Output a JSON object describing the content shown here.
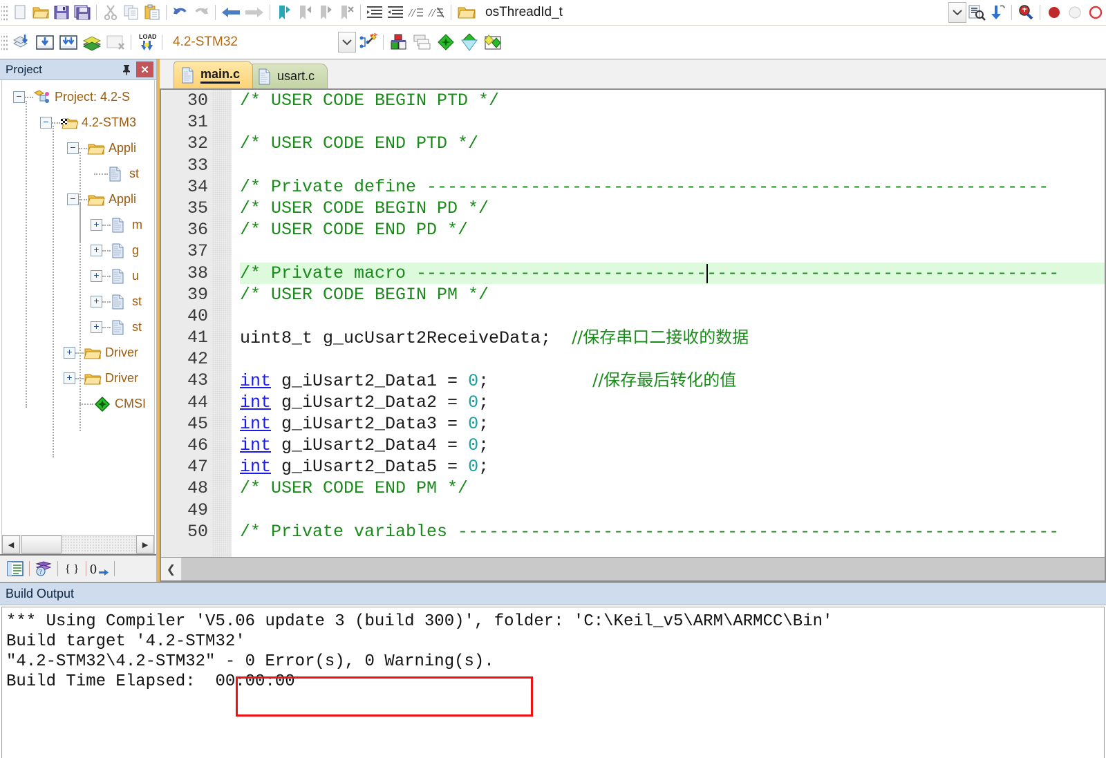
{
  "toolbar_top": {
    "icons": [
      {
        "name": "new-file-icon",
        "glyph": "new"
      },
      {
        "name": "open-file-icon",
        "glyph": "folder"
      },
      {
        "name": "save-icon",
        "glyph": "save"
      },
      {
        "name": "save-all-icon",
        "glyph": "saveall"
      },
      {
        "name": "cut-icon",
        "glyph": "cut"
      },
      {
        "name": "copy-icon",
        "glyph": "copy"
      },
      {
        "name": "paste-icon",
        "glyph": "paste"
      },
      {
        "name": "undo-icon",
        "glyph": "undo"
      },
      {
        "name": "redo-icon",
        "glyph": "redo"
      },
      {
        "name": "navigate-back-icon",
        "glyph": "back"
      },
      {
        "name": "navigate-forward-icon",
        "glyph": "forward"
      },
      {
        "name": "bookmark-toggle-icon",
        "glyph": "bm1"
      },
      {
        "name": "bookmark-prev-icon",
        "glyph": "bm2"
      },
      {
        "name": "bookmark-next-icon",
        "glyph": "bm3"
      },
      {
        "name": "bookmark-clear-icon",
        "glyph": "bm4"
      },
      {
        "name": "indent-icon",
        "glyph": "ind1"
      },
      {
        "name": "outdent-icon",
        "glyph": "ind2"
      },
      {
        "name": "comment-icon",
        "glyph": "com1"
      },
      {
        "name": "uncomment-icon",
        "glyph": "com2"
      }
    ],
    "symbol_icon": "find-symbol-icon",
    "symbol_value": "osThreadId_t",
    "right_icons": [
      {
        "name": "dropdown-arrow-icon",
        "glyph": "chev"
      },
      {
        "name": "find-in-files-icon",
        "glyph": "findfiles"
      },
      {
        "name": "insert-icon",
        "glyph": "insert"
      },
      {
        "name": "debug-magnifier-icon",
        "glyph": "dbgmag"
      },
      {
        "name": "breakpoint-set-icon",
        "glyph": "bpred"
      },
      {
        "name": "breakpoint-disabled-icon",
        "glyph": "bpgray"
      },
      {
        "name": "breakpoint-clear-icon",
        "glyph": "bphollow"
      }
    ]
  },
  "toolbar_build": {
    "icons": [
      {
        "name": "translate-icon",
        "glyph": "translate"
      },
      {
        "name": "build-icon",
        "glyph": "build"
      },
      {
        "name": "rebuild-icon",
        "glyph": "rebuild"
      },
      {
        "name": "batch-build-icon",
        "glyph": "batch"
      },
      {
        "name": "stop-build-icon",
        "glyph": "stopbuild"
      },
      {
        "name": "download-icon",
        "glyph": "load"
      }
    ],
    "target_label": "4.2-STM32",
    "target_dropdown_icon": "chevron-down-icon",
    "right_icons": [
      {
        "name": "target-options-wizard-icon",
        "glyph": "wizard"
      },
      {
        "name": "manage-project-items-icon",
        "glyph": "mgr"
      },
      {
        "name": "multi-project-icon",
        "glyph": "multi"
      },
      {
        "name": "pack-installer-icon",
        "glyph": "pack1"
      },
      {
        "name": "manage-runtime-env-icon",
        "glyph": "pack2"
      },
      {
        "name": "select-software-packs-icon",
        "glyph": "pack3"
      }
    ]
  },
  "project_panel": {
    "title": "Project",
    "pin_icon": "pin-icon",
    "close_icon": "close-icon",
    "tree": [
      {
        "label": "Project: 4.2-S",
        "icon": "project-icon",
        "expander": "−",
        "depth": 0
      },
      {
        "label": "4.2-STM3",
        "icon": "target-icon",
        "expander": "−",
        "depth": 1
      },
      {
        "label": "Appli",
        "icon": "folder-icon",
        "expander": "−",
        "depth": 2
      },
      {
        "label": "st",
        "icon": "file-icon",
        "expander": "",
        "depth": 3
      },
      {
        "label": "Appli",
        "icon": "folder-icon",
        "expander": "−",
        "depth": 2
      },
      {
        "label": "m",
        "icon": "file-icon",
        "expander": "+",
        "depth": 3
      },
      {
        "label": "g",
        "icon": "file-icon",
        "expander": "+",
        "depth": 3
      },
      {
        "label": "u",
        "icon": "file-icon",
        "expander": "+",
        "depth": 3
      },
      {
        "label": "st",
        "icon": "file-icon",
        "expander": "+",
        "depth": 3
      },
      {
        "label": "st",
        "icon": "file-icon",
        "expander": "+",
        "depth": 3
      },
      {
        "label": "Driver",
        "icon": "folder-icon",
        "expander": "+",
        "depth": 2
      },
      {
        "label": "Driver",
        "icon": "folder-icon",
        "expander": "+",
        "depth": 2
      },
      {
        "label": "CMSI",
        "icon": "cmsis-icon",
        "expander": "",
        "depth": 2
      }
    ],
    "hscroll": {
      "left_icon": "scroll-left-arrow-icon",
      "right_icon": "scroll-right-arrow-icon"
    },
    "bottom_tabs": [
      {
        "name": "project-view-tab",
        "glyph": "▤"
      },
      {
        "name": "books-view-tab",
        "glyph": "books"
      },
      {
        "name": "functions-view-tab",
        "glyph": "{}"
      },
      {
        "name": "templates-view-tab",
        "glyph": "0→"
      }
    ]
  },
  "editor": {
    "tabs": [
      {
        "label": "main.c",
        "active": true,
        "icon": "file-icon"
      },
      {
        "label": "usart.c",
        "active": false,
        "icon": "file-icon"
      }
    ],
    "first_line_number": 30,
    "highlight_line": 38,
    "lines": [
      {
        "n": 30,
        "segments": [
          {
            "t": "/* USER CODE BEGIN PTD */",
            "c": "cm"
          }
        ]
      },
      {
        "n": 31,
        "segments": []
      },
      {
        "n": 32,
        "segments": [
          {
            "t": "/* USER CODE END PTD */",
            "c": "cm"
          }
        ]
      },
      {
        "n": 33,
        "segments": []
      },
      {
        "n": 34,
        "segments": [
          {
            "t": "/* Private define ------------------------------------------------------------",
            "c": "cm"
          }
        ]
      },
      {
        "n": 35,
        "segments": [
          {
            "t": "/* USER CODE BEGIN PD */",
            "c": "cm"
          }
        ]
      },
      {
        "n": 36,
        "segments": [
          {
            "t": "/* USER CODE END PD */",
            "c": "cm"
          }
        ]
      },
      {
        "n": 37,
        "segments": []
      },
      {
        "n": 38,
        "segments": [
          {
            "t": "/* Private macro --------------------------------------------------------------",
            "c": "cm"
          }
        ]
      },
      {
        "n": 39,
        "segments": [
          {
            "t": "/* USER CODE BEGIN PM */",
            "c": "cm"
          }
        ]
      },
      {
        "n": 40,
        "segments": []
      },
      {
        "n": 41,
        "segments": [
          {
            "t": "uint8_t g_ucUsart2ReceiveData;  ",
            "c": ""
          },
          {
            "t": "//保存串口二接收的数据",
            "c": "cn"
          }
        ]
      },
      {
        "n": 42,
        "segments": []
      },
      {
        "n": 43,
        "segments": [
          {
            "t": "int",
            "c": "kw"
          },
          {
            "t": " g_iUsart2_Data1 = ",
            "c": ""
          },
          {
            "t": "0",
            "c": "num"
          },
          {
            "t": ";          ",
            "c": ""
          },
          {
            "t": "//保存最后转化的值",
            "c": "cn"
          }
        ]
      },
      {
        "n": 44,
        "segments": [
          {
            "t": "int",
            "c": "kw"
          },
          {
            "t": " g_iUsart2_Data2 = ",
            "c": ""
          },
          {
            "t": "0",
            "c": "num"
          },
          {
            "t": ";",
            "c": ""
          }
        ]
      },
      {
        "n": 45,
        "segments": [
          {
            "t": "int",
            "c": "kw"
          },
          {
            "t": " g_iUsart2_Data3 = ",
            "c": ""
          },
          {
            "t": "0",
            "c": "num"
          },
          {
            "t": ";",
            "c": ""
          }
        ]
      },
      {
        "n": 46,
        "segments": [
          {
            "t": "int",
            "c": "kw"
          },
          {
            "t": " g_iUsart2_Data4 = ",
            "c": ""
          },
          {
            "t": "0",
            "c": "num"
          },
          {
            "t": ";",
            "c": ""
          }
        ]
      },
      {
        "n": 47,
        "segments": [
          {
            "t": "int",
            "c": "kw"
          },
          {
            "t": " g_iUsart2_Data5 = ",
            "c": ""
          },
          {
            "t": "0",
            "c": "num"
          },
          {
            "t": ";",
            "c": ""
          }
        ]
      },
      {
        "n": 48,
        "segments": [
          {
            "t": "/* USER CODE END PM */",
            "c": "cm"
          }
        ]
      },
      {
        "n": 49,
        "segments": []
      },
      {
        "n": 50,
        "segments": [
          {
            "t": "/* Private variables ----------------------------------------------------------",
            "c": "cm"
          }
        ]
      }
    ],
    "hscroll_left_icon": "scroll-left-arrow-icon"
  },
  "build_output": {
    "title": "Build Output",
    "lines": [
      "*** Using Compiler 'V5.06 update 3 (build 300)', folder: 'C:\\Keil_v5\\ARM\\ARMCC\\Bin'",
      "Build target '4.2-STM32'",
      "\"4.2-STM32\\4.2-STM32\" - 0 Error(s), 0 Warning(s).",
      "Build Time Elapsed:  00:00:00"
    ],
    "highlight_box_color": "#ee1111"
  }
}
